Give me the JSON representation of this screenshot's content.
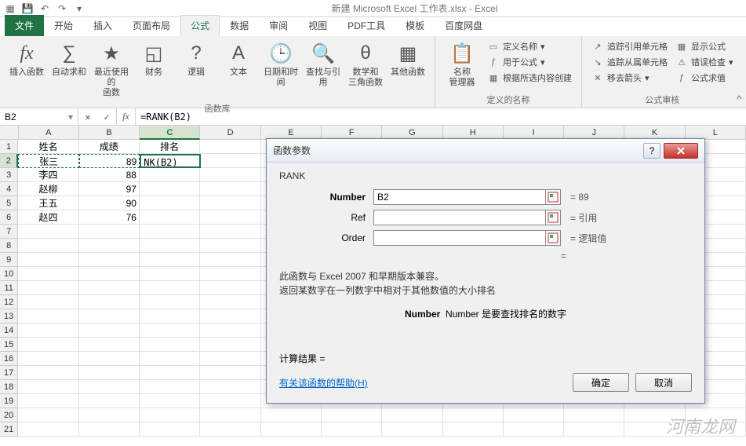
{
  "titlebar": {
    "title": "新建 Microsoft Excel 工作表.xlsx - Excel"
  },
  "tabs": {
    "file": "文件",
    "items": [
      "开始",
      "插入",
      "页面布局",
      "公式",
      "数据",
      "审阅",
      "视图",
      "PDF工具",
      "模板",
      "百度网盘"
    ],
    "activeIndex": 3
  },
  "ribbon": {
    "insertFn": "插入函数",
    "autosum": "自动求和",
    "recent": "最近使用的\n函数",
    "financial": "财务",
    "logical": "逻辑",
    "text": "文本",
    "datetime": "日期和时间",
    "lookup": "查找与引用",
    "math": "数学和\n三角函数",
    "more": "其他函数",
    "libLabel": "函数库",
    "nameMgr": "名称\n管理器",
    "defName": "定义名称",
    "useInFormula": "用于公式",
    "createFromSel": "根据所选内容创建",
    "namesLabel": "定义的名称",
    "tracePrec": "追踪引用单元格",
    "traceDep": "追踪从属单元格",
    "removeArrows": "移去箭头",
    "showFormulas": "显示公式",
    "errorCheck": "错误检查",
    "evalFormula": "公式求值",
    "auditLabel": "公式审核"
  },
  "fbar": {
    "name": "B2",
    "formula": "=RANK(B2)"
  },
  "grid": {
    "cols": [
      "A",
      "B",
      "C",
      "D",
      "E",
      "F",
      "G",
      "H",
      "I",
      "J",
      "K",
      "L"
    ],
    "rows": 21,
    "data": [
      {
        "A": "姓名",
        "B": "成绩",
        "C": "排名"
      },
      {
        "A": "张三",
        "B": "89",
        "C": "NK(B2)"
      },
      {
        "A": "李四",
        "B": "88"
      },
      {
        "A": "赵柳",
        "B": "97"
      },
      {
        "A": "王五",
        "B": "90"
      },
      {
        "A": "赵四",
        "B": "76"
      }
    ]
  },
  "dialog": {
    "title": "函数参数",
    "fn": "RANK",
    "params": [
      {
        "label": "Number",
        "value": "B2",
        "result": "= 89",
        "bold": true
      },
      {
        "label": "Ref",
        "value": "",
        "result": "= 引用"
      },
      {
        "label": "Order",
        "value": "",
        "result": "= 逻辑值"
      }
    ],
    "eq": "=",
    "desc1": "此函数与 Excel 2007 和早期版本兼容。",
    "desc2": "返回某数字在一列数字中相对于其他数值的大小排名",
    "paramDesc": "Number  是要查找排名的数字",
    "result": "计算结果 =",
    "helpLink": "有关该函数的帮助(H)",
    "ok": "确定",
    "cancel": "取消"
  },
  "watermark": "河南龙网"
}
